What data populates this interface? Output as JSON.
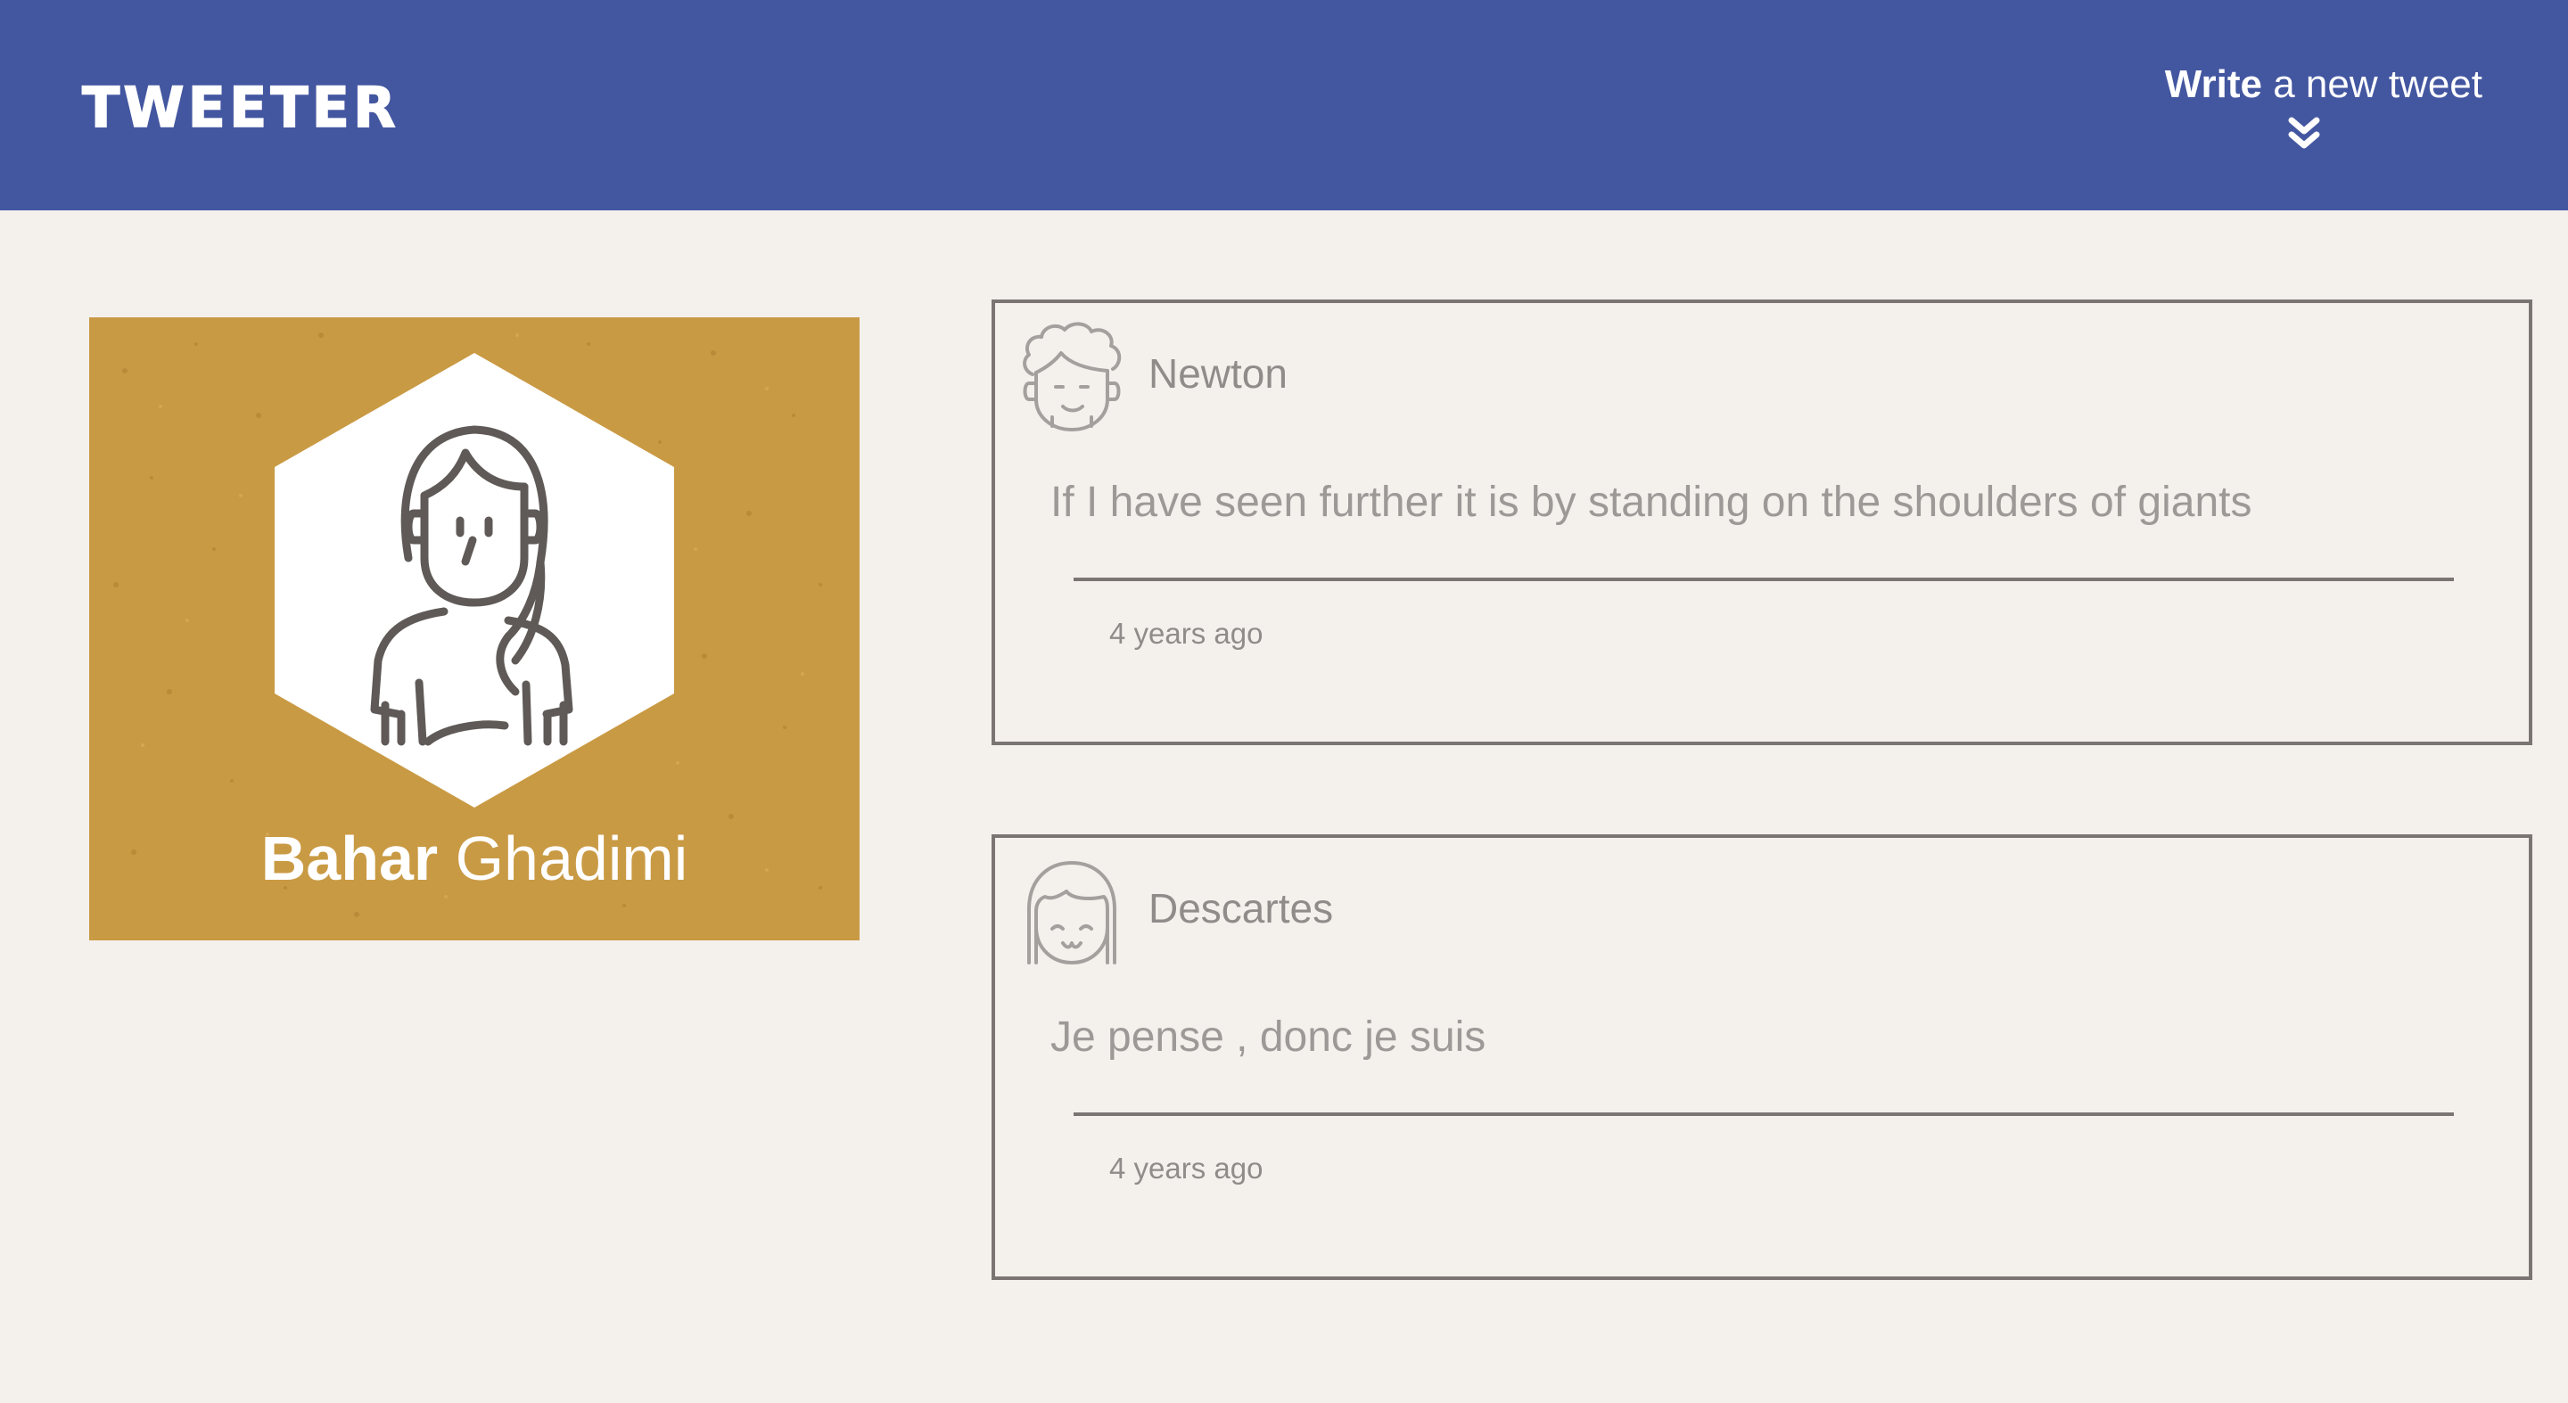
{
  "header": {
    "brand": "TWEETER",
    "compose": {
      "strong": "Write",
      "rest": " a new tweet",
      "icon": "double-chevron-down-icon"
    }
  },
  "profile": {
    "first_name": "Bahar",
    "last_name": "Ghadimi",
    "avatar_icon": "girl-avatar-icon",
    "colors": {
      "card_background": "#c99a44",
      "hexagon": "#ffffff"
    }
  },
  "tweets": [
    {
      "author": "Newton",
      "avatar_icon": "curly-hair-avatar-icon",
      "content": "If I have seen further it is by standing on the shoulders of giants",
      "time": "4 years ago"
    },
    {
      "author": "Descartes",
      "avatar_icon": "bob-hair-avatar-icon",
      "content": "Je pense , donc je suis",
      "time": "4 years ago"
    }
  ],
  "colors": {
    "nav_background": "#4356a0",
    "page_background": "#f4f1ed",
    "border": "#7a7573",
    "muted_text": "#8f8c8a"
  }
}
